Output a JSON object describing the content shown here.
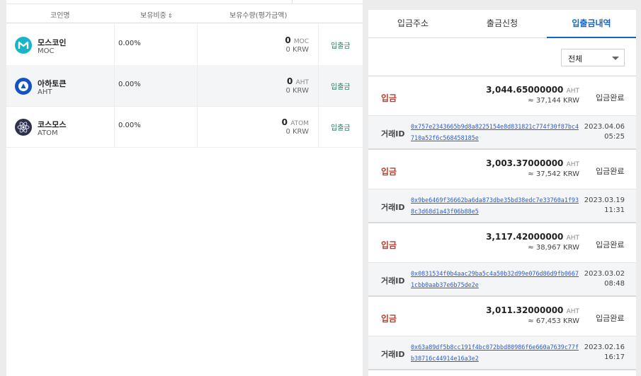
{
  "holdings": {
    "headers": {
      "coin": "코인명",
      "ratio": "보유비중",
      "sort_icon": "⇕",
      "amount": "보유수량(평가금액)"
    },
    "rows": [
      {
        "name": "모스코인",
        "symbol": "MOC",
        "ratio": "0.00%",
        "qty": "0",
        "qty_unit": "MOC",
        "krw": "0",
        "krw_unit": "KRW",
        "action": "입출금",
        "icon": "moc-coin-icon",
        "color": "#18b4c8"
      },
      {
        "name": "아하토큰",
        "symbol": "AHT",
        "ratio": "0.00%",
        "qty": "0",
        "qty_unit": "AHT",
        "krw": "0",
        "krw_unit": "KRW",
        "action": "입출금",
        "icon": "aht-token-icon",
        "color": "#1452c8"
      },
      {
        "name": "코스모스",
        "symbol": "ATOM",
        "ratio": "0.00%",
        "qty": "0",
        "qty_unit": "ATOM",
        "krw": "0",
        "krw_unit": "KRW",
        "action": "입출금",
        "icon": "atom-coin-icon",
        "color": "#2e3148"
      }
    ]
  },
  "panel": {
    "tabs": [
      "입금주소",
      "출금신청",
      "입출금내역"
    ],
    "active_tab": 2,
    "filter": {
      "selected": "전체"
    },
    "tx_id_label": "거래ID",
    "transactions": [
      {
        "type": "입금",
        "amount": "3,044.65000000",
        "unit": "AHT",
        "krw": "≈ 37,144 KRW",
        "status": "입금완료",
        "hash": "0x757e2343665b9d8a8225154e8d831821c774f30f87bc4710a52f6c568458185e",
        "date": "2023.04.06",
        "time": "05:25"
      },
      {
        "type": "입금",
        "amount": "3,003.37000000",
        "unit": "AHT",
        "krw": "≈ 37,542 KRW",
        "status": "입금완료",
        "hash": "0x9be6469f36662ba6da873dbe35bd38edc7e33760a1f938c3d68d1a43f06b88e5",
        "date": "2023.03.19",
        "time": "11:31"
      },
      {
        "type": "입금",
        "amount": "3,117.42000000",
        "unit": "AHT",
        "krw": "≈ 38,967 KRW",
        "status": "입금완료",
        "hash": "0x0831534f0b4aac29ba5c4a50b32d99e076d86d9fb06671cbb0aab37e6b75de2e",
        "date": "2023.03.02",
        "time": "08:48"
      },
      {
        "type": "입금",
        "amount": "3,011.32000000",
        "unit": "AHT",
        "krw": "≈ 67,453 KRW",
        "status": "입금완료",
        "hash": "0x63a89df5b8cc191f4bc072bbd80986f6e660a7639c77fb38716c44914e16a3e2",
        "date": "2023.02.16",
        "time": "16:17"
      }
    ]
  }
}
